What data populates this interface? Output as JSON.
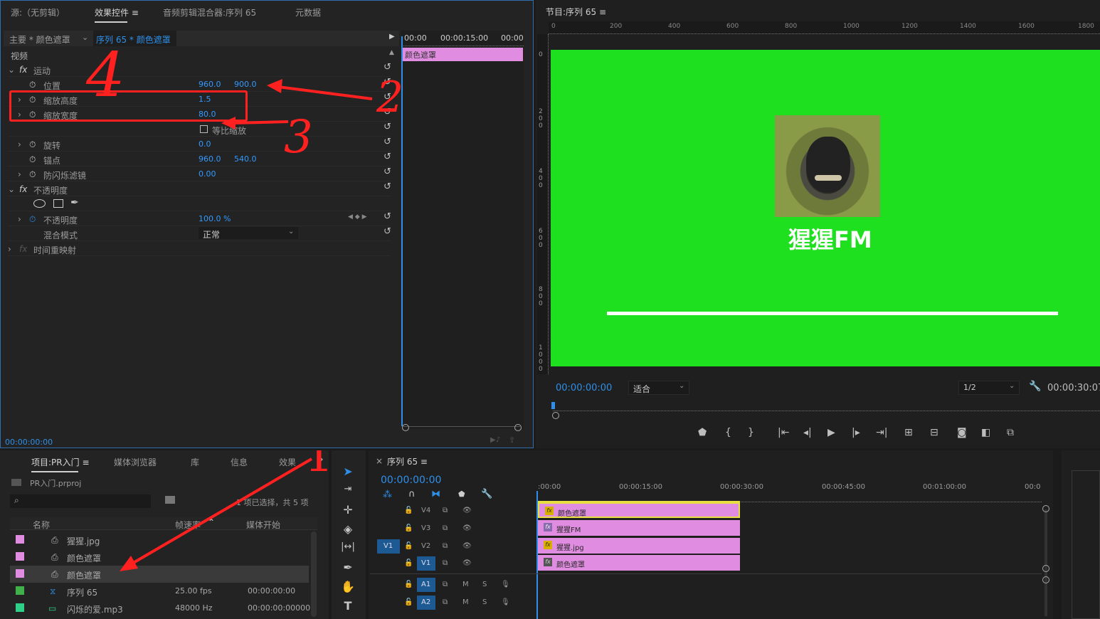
{
  "effect_panel": {
    "tabs": [
      "源:（无剪辑）",
      "效果控件",
      "音频剪辑混合器:序列 65",
      "元数据"
    ],
    "menu_glyph": "≡",
    "master_label": "主要 * 颜色遮罩",
    "sequence_clip_label": "序列 65 * 颜色遮罩",
    "mini_timecodes": [
      "00:00",
      "00:00:15:00",
      "00:00"
    ],
    "clip_bar": "颜色遮罩",
    "video_header": "视频",
    "rows": {
      "motion": "运动",
      "position": "位置",
      "position_x": "960.0",
      "position_y": "900.0",
      "scale_height": "缩放高度",
      "scale_height_val": "1.5",
      "scale_width": "缩放宽度",
      "scale_width_val": "80.0",
      "uniform_scale": "等比缩放",
      "rotation": "旋转",
      "rotation_val": "0.0",
      "anchor": "锚点",
      "anchor_x": "960.0",
      "anchor_y": "540.0",
      "anti_flicker": "防闪烁滤镜",
      "anti_flicker_val": "0.00",
      "opacity_group": "不透明度",
      "opacity": "不透明度",
      "opacity_val": "100.0 %",
      "blend_mode": "混合模式",
      "blend_val": "正常",
      "time_remap": "时间重映射"
    },
    "fx_glyph": "fx",
    "footer_time": "00:00:00:00"
  },
  "program_monitor": {
    "title": "节目:序列 65",
    "menu_glyph": "≡",
    "ruler_top": [
      "0",
      "200",
      "400",
      "600",
      "800",
      "1000",
      "1200",
      "1400",
      "1600",
      "1800"
    ],
    "ruler_left": [
      "0",
      "2 0 0",
      "4 0 0",
      "6 0 0",
      "8 0 0",
      "1 0 0 0"
    ],
    "overlay_title": "猩猩FM",
    "timecode": "00:00:00:00",
    "fit_label": "适合",
    "resolution": "1/2",
    "duration": "00:00:30:07",
    "colors": {
      "green": "#1ee01e",
      "pink": "#e08ce0",
      "accent": "#2f8fe8"
    }
  },
  "project_panel": {
    "tabs": [
      "项目:PR入门",
      "媒体浏览器",
      "库",
      "信息",
      "效果"
    ],
    "more_glyph": "»",
    "file_name": "PR入门.prproj",
    "selection_info": "1 项已选择，共 5 项",
    "columns": [
      "名称",
      "帧速率",
      "媒体开始"
    ],
    "items": [
      {
        "name": "猩猩.jpg",
        "fps": "",
        "start": "",
        "color": "#e08ce0"
      },
      {
        "name": "颜色遮罩",
        "fps": "",
        "start": "",
        "color": "#e08ce0"
      },
      {
        "name": "颜色遮罩",
        "fps": "",
        "start": "",
        "color": "#e08ce0"
      },
      {
        "name": "序列 65",
        "fps": "25.00 fps",
        "start": "00:00:00:00",
        "color": "#3fb04a"
      },
      {
        "name": "闪烁的爱.mp3",
        "fps": "48000 Hz",
        "start": "00:00:00:00000",
        "color": "#2fcf8a"
      }
    ]
  },
  "timeline": {
    "close_glyph": "×",
    "title": "序列 65",
    "menu_glyph": "≡",
    "timecode": "00:00:00:00",
    "ruler": [
      ":00:00",
      "00:00:15:00",
      "00:00:30:00",
      "00:00:45:00",
      "00:01:00:00",
      "00:0"
    ],
    "video_tracks": [
      "V4",
      "V3",
      "V2",
      "V1"
    ],
    "source_patch": "V1",
    "audio_tracks": [
      "A1",
      "A2"
    ],
    "mute_label": "M",
    "solo_label": "S",
    "clips": [
      "颜色遮罩",
      "猩猩FM",
      "猩猩.jpg",
      "颜色遮罩"
    ]
  },
  "annotations": [
    "4",
    "2",
    "3",
    "1"
  ]
}
